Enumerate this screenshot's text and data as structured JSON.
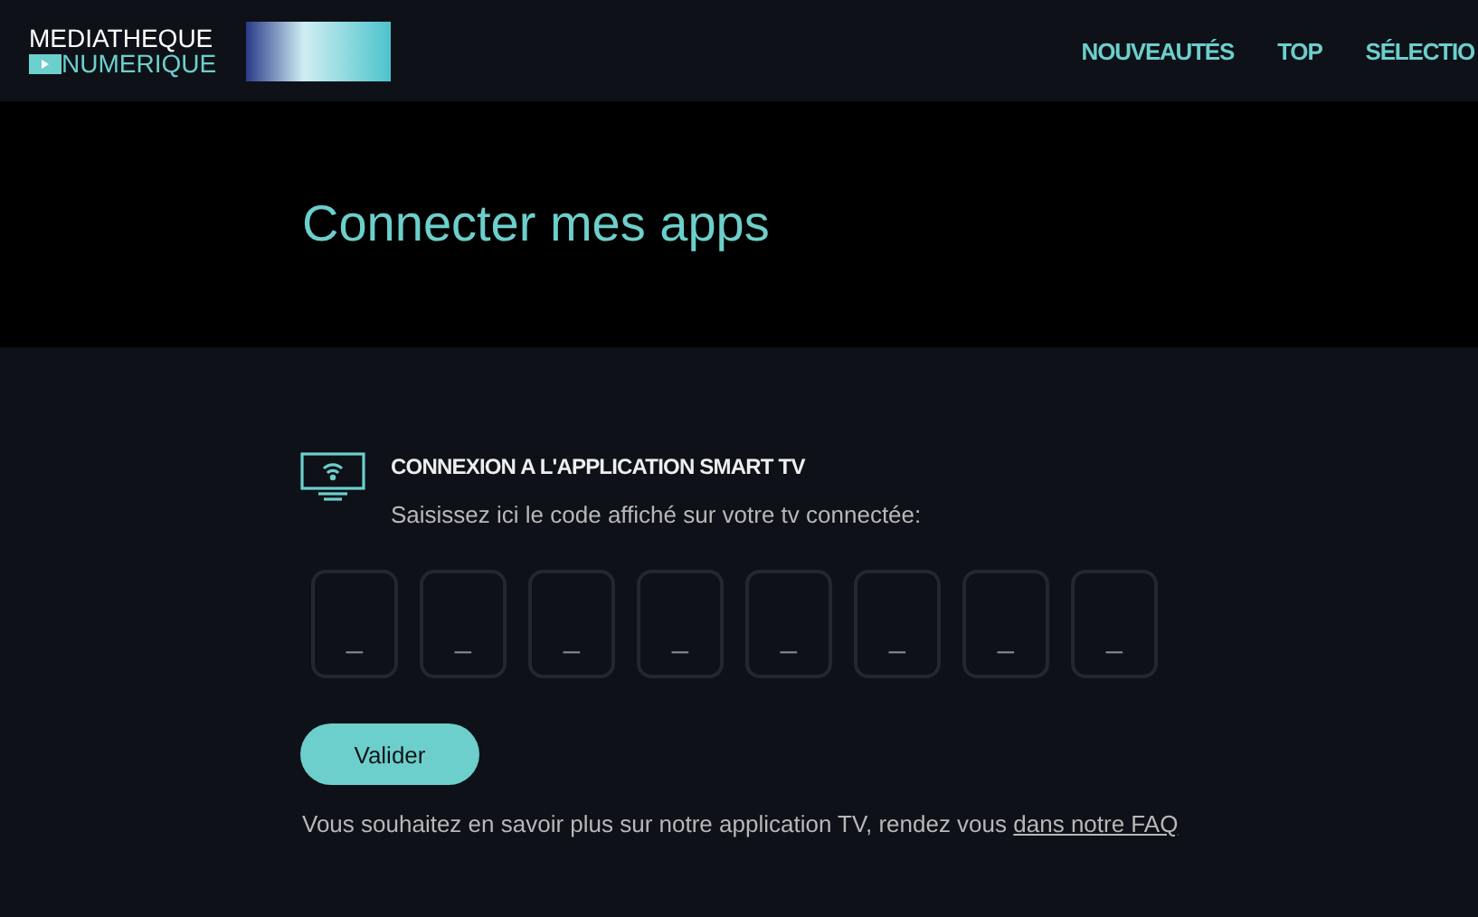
{
  "header": {
    "logo": {
      "line_1": "MEDIATHEQUE",
      "line_2": "NUMERIQUE"
    },
    "nav": [
      {
        "label": "NOUVEAUTÉS"
      },
      {
        "label": "TOP"
      },
      {
        "label": "SÉLECTIO"
      }
    ]
  },
  "hero": {
    "title": "Connecter mes apps"
  },
  "section": {
    "title": "CONNEXION A L'APPLICATION SMART TV",
    "instructions": "Saisissez ici le code affiché sur votre tv connectée:",
    "code_inputs": [
      {
        "placeholder": "_"
      },
      {
        "placeholder": "_"
      },
      {
        "placeholder": "_"
      },
      {
        "placeholder": "_"
      },
      {
        "placeholder": "_"
      },
      {
        "placeholder": "_"
      },
      {
        "placeholder": "_"
      },
      {
        "placeholder": "_"
      }
    ],
    "submit": "Valider",
    "info": "Vous souhaitez en savoir plus sur notre application TV, rendez vous ",
    "info_link": "dans notre FAQ"
  }
}
